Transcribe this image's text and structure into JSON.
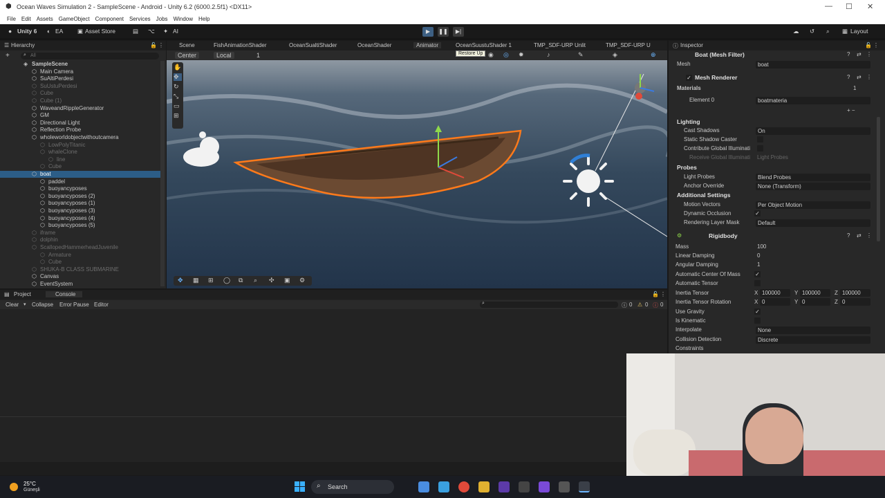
{
  "window": {
    "title": "Ocean Waves Simulation 2 - SampleScene - Android - Unity 6.2 (6000.2.5f1) <DX11>",
    "minimize": "—",
    "maximize": "☐",
    "close": "✕"
  },
  "menu": [
    "File",
    "Edit",
    "Assets",
    "GameObject",
    "Component",
    "Services",
    "Jobs",
    "Window",
    "Help"
  ],
  "toolbar": {
    "account": "Unity 6",
    "ea": "EA",
    "asset_store": "Asset Store",
    "ai": "AI",
    "layout": "Layout",
    "play": "▶",
    "pause": "❚❚",
    "step": "▶|"
  },
  "hierarchy": {
    "tab": "Hierarchy",
    "search": "All",
    "items": [
      {
        "label": "SampleScene",
        "indent": 0,
        "style": "bold"
      },
      {
        "label": "Main Camera",
        "indent": 1,
        "style": "normal"
      },
      {
        "label": "SuAltiPerdesi",
        "indent": 1,
        "style": "normal"
      },
      {
        "label": "SuUstuPerdesi",
        "indent": 1,
        "style": "dim"
      },
      {
        "label": "Cube",
        "indent": 1,
        "style": "dim"
      },
      {
        "label": "Cube (1)",
        "indent": 1,
        "style": "dim"
      },
      {
        "label": "WaveandRippleGenerator",
        "indent": 1,
        "style": "normal"
      },
      {
        "label": "GM",
        "indent": 1,
        "style": "normal"
      },
      {
        "label": "Directional Light",
        "indent": 1,
        "style": "normal"
      },
      {
        "label": "Reflection Probe",
        "indent": 1,
        "style": "normal"
      },
      {
        "label": "wholeworldobjectwithoutcamera",
        "indent": 1,
        "style": "normal"
      },
      {
        "label": "LowPolyTitanic",
        "indent": 2,
        "style": "dim"
      },
      {
        "label": "whaleClone",
        "indent": 2,
        "style": "dim"
      },
      {
        "label": "line",
        "indent": 3,
        "style": "dim"
      },
      {
        "label": "Cube",
        "indent": 2,
        "style": "dim"
      },
      {
        "label": "boat",
        "indent": 1,
        "style": "selected"
      },
      {
        "label": "paddel",
        "indent": 2,
        "style": "normal"
      },
      {
        "label": "buoyancyposes",
        "indent": 2,
        "style": "normal"
      },
      {
        "label": "buoyancyposes (2)",
        "indent": 2,
        "style": "normal"
      },
      {
        "label": "buoyancyposes (1)",
        "indent": 2,
        "style": "normal"
      },
      {
        "label": "buoyancyposes (3)",
        "indent": 2,
        "style": "normal"
      },
      {
        "label": "buoyancyposes (4)",
        "indent": 2,
        "style": "normal"
      },
      {
        "label": "buoyancyposes (5)",
        "indent": 2,
        "style": "normal"
      },
      {
        "label": "iframe",
        "indent": 1,
        "style": "dim"
      },
      {
        "label": "dolphin",
        "indent": 1,
        "style": "dim"
      },
      {
        "label": "ScallopedHammerheadJuvenile",
        "indent": 1,
        "style": "dim"
      },
      {
        "label": "Armature",
        "indent": 2,
        "style": "dim"
      },
      {
        "label": "Cube",
        "indent": 2,
        "style": "dim"
      },
      {
        "label": "SHUKA-B CLASS SUBMARINE",
        "indent": 1,
        "style": "dim"
      },
      {
        "label": "Canvas",
        "indent": 1,
        "style": "normal"
      },
      {
        "label": "EventSystem",
        "indent": 1,
        "style": "normal"
      }
    ]
  },
  "scene_tabs": [
    "Scene",
    "FishAnimationShader",
    "OceanSualtiShader",
    "OceanShader",
    "Animator",
    "OceanSuustuShader 1",
    "TMP_SDF-URP Unlit",
    "TMP_SDF-URP U"
  ],
  "scene_toolbar": {
    "pivot": "Center",
    "space": "Local",
    "snap": "1",
    "tooltip": "Restore Up"
  },
  "bottom": {
    "tabs": [
      "Project",
      "Console"
    ],
    "clear": "Clear",
    "collapse": "Collapse",
    "error_pause": "Error Pause",
    "editor": "Editor",
    "count_info": "0",
    "count_warn": "0",
    "count_err": "0"
  },
  "inspector": {
    "tab": "Inspector",
    "mesh_filter": {
      "title": "Boat (Mesh Filter)",
      "mesh_label": "Mesh",
      "mesh_value": "boat"
    },
    "mesh_renderer": {
      "title": "Mesh Renderer",
      "materials": "Materials",
      "materials_count": "1",
      "element0": "Element 0",
      "element0_value": "boatmateria",
      "lighting": "Lighting",
      "cast_shadows": "Cast Shadows",
      "cast_shadows_value": "On",
      "static_shadow": "Static Shadow Caster",
      "contribute_gi": "Contribute Global Illuminati",
      "receive_gi": "Receive Global Illuminati",
      "receive_gi_value": "Light Probes",
      "probes": "Probes",
      "light_probes": "Light Probes",
      "light_probes_value": "Blend Probes",
      "anchor_override": "Anchor Override",
      "anchor_override_value": "None (Transform)",
      "additional": "Additional Settings",
      "motion_vectors": "Motion Vectors",
      "motion_vectors_value": "Per Object Motion",
      "dynamic_occlusion": "Dynamic Occlusion",
      "rendering_layer": "Rendering Layer Mask",
      "rendering_layer_value": "Default"
    },
    "rigidbody": {
      "title": "Rigidbody",
      "mass": "Mass",
      "mass_value": "100",
      "linear_damping": "Linear Damping",
      "linear_damping_value": "0",
      "angular_damping": "Angular Damping",
      "angular_damping_value": "1",
      "auto_com": "Automatic Center Of Mass",
      "auto_tensor": "Automatic Tensor",
      "inertia_tensor": "Inertia Tensor",
      "it_x": "100000",
      "it_y": "100000",
      "it_z": "100000",
      "inertia_rot": "Inertia Tensor Rotation",
      "ir_x": "0",
      "ir_y": "0",
      "ir_z": "0",
      "use_gravity": "Use Gravity",
      "is_kinematic": "Is Kinematic",
      "interpolate": "Interpolate",
      "interpolate_value": "None",
      "collision": "Collision Detection",
      "collision_value": "Discrete",
      "constraints": "Constraints"
    }
  },
  "taskbar": {
    "temp": "25°C",
    "weather": "Güneşli",
    "search": "Search"
  },
  "colors": {
    "accent": "#2c5d87",
    "selection_outline": "#ff7a1a",
    "panel": "#282828"
  }
}
